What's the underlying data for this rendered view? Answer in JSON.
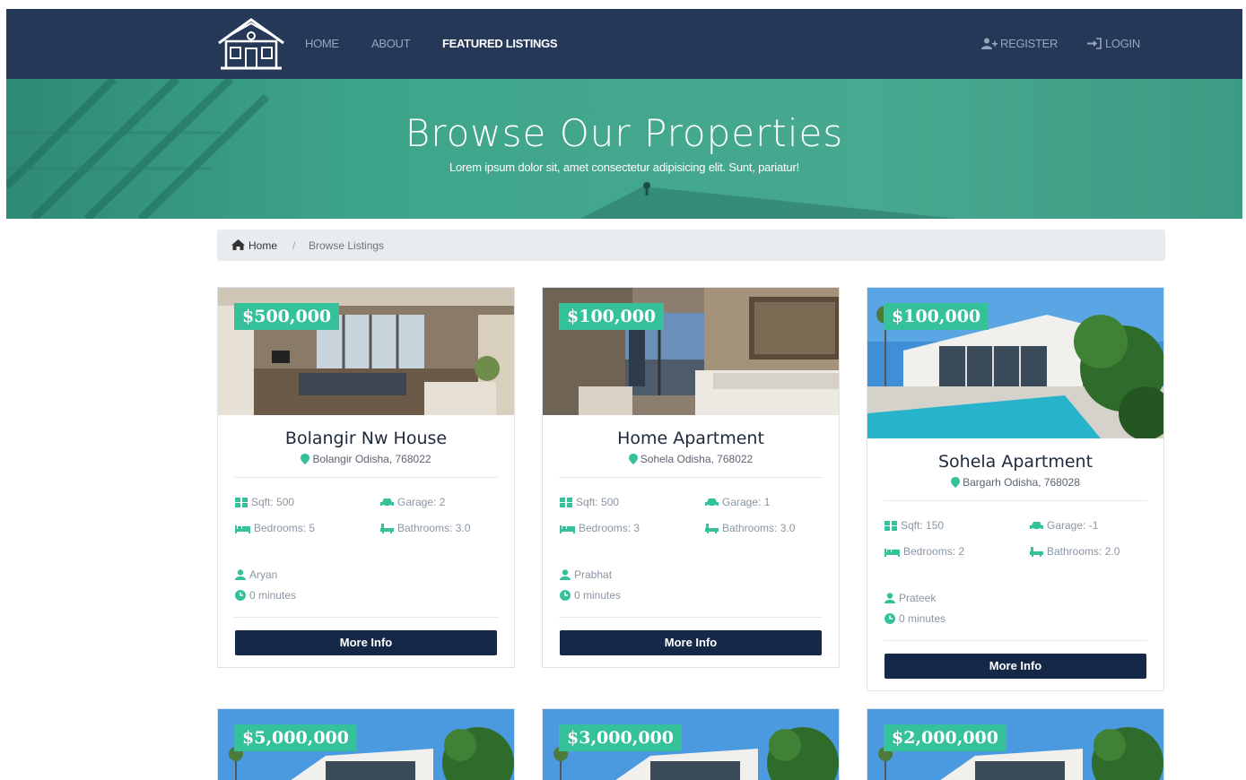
{
  "nav": {
    "links": [
      "HOME",
      "ABOUT",
      "FEATURED LISTINGS"
    ],
    "register": "REGISTER",
    "login": "LOGIN"
  },
  "hero": {
    "title": "Browse Our Properties",
    "subtitle": "Lorem ipsum dolor sit, amet consectetur adipisicing elit. Sunt, pariatur!"
  },
  "breadcrumb": {
    "home": "Home",
    "separator": "/",
    "current": "Browse Listings"
  },
  "listings": [
    {
      "price": "$500,000",
      "title": "Bolangir Nw House",
      "location": "Bolangir Odisha, 768022",
      "sqft": "Sqft: 500",
      "garage": "Garage: 2",
      "bedrooms": "Bedrooms: 5",
      "bathrooms": "Bathrooms: 3.0",
      "realtor": "Aryan",
      "time": "0 minutes",
      "button": "More Info"
    },
    {
      "price": "$100,000",
      "title": "Home Apartment",
      "location": "Sohela Odisha, 768022",
      "sqft": "Sqft: 500",
      "garage": "Garage: 1",
      "bedrooms": "Bedrooms: 3",
      "bathrooms": "Bathrooms: 3.0",
      "realtor": "Prabhat",
      "time": "0 minutes",
      "button": "More Info"
    },
    {
      "price": "$100,000",
      "title": "Sohela Apartment",
      "location": "Bargarh Odisha, 768028",
      "sqft": "Sqft: 150",
      "garage": "Garage: -1",
      "bedrooms": "Bedrooms: 2",
      "bathrooms": "Bathrooms: 2.0",
      "realtor": "Prateek",
      "time": "0 minutes",
      "button": "More Info"
    },
    {
      "price": "$5,000,000"
    },
    {
      "price": "$3,000,000"
    },
    {
      "price": "$2,000,000"
    }
  ],
  "colors": {
    "navbar": "#253858",
    "hero": "#3ea58b",
    "price_badge": "#35c29a",
    "button": "#152847"
  }
}
